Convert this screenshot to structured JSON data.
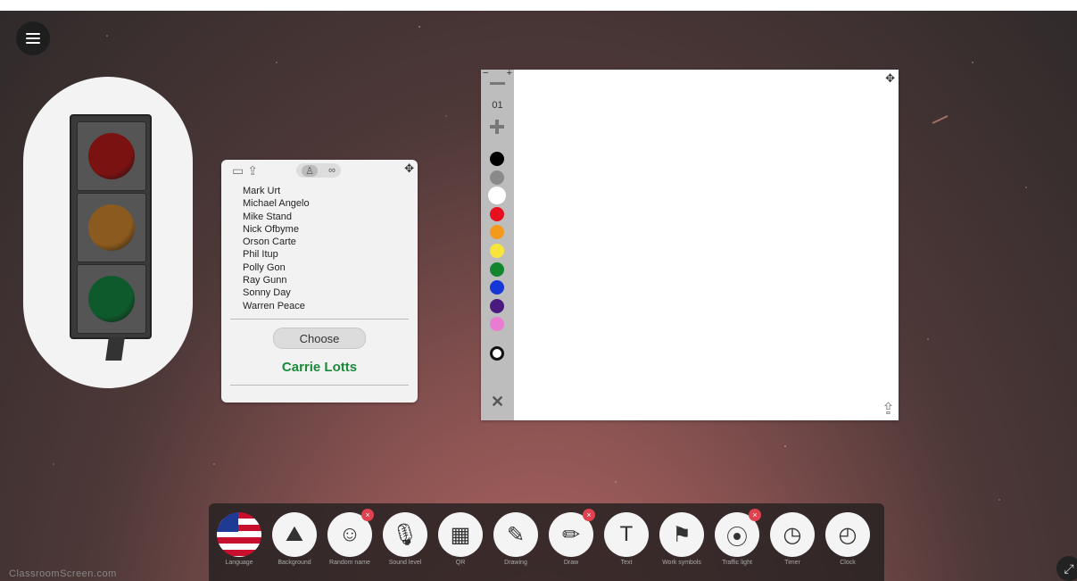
{
  "app": {
    "watermark": "ClassroomScreen.com"
  },
  "menu": {
    "icon": "hamburger-icon"
  },
  "traffic_light": {
    "lamps": [
      {
        "color": "#7a1212"
      },
      {
        "color": "#8a5a1e"
      },
      {
        "color": "#0f5a2c"
      }
    ]
  },
  "name_picker": {
    "names": [
      "Mark Urt",
      "Michael Angelo",
      "Mike Stand",
      "Nick Ofbyme",
      "Orson Carte",
      "Phil Itup",
      "Polly Gon",
      "Ray Gunn",
      "Sonny Day",
      "Warren Peace"
    ],
    "choose_label": "Choose",
    "chosen": "Carrie Lotts",
    "winner_color": "#1a8a3a"
  },
  "drawing": {
    "pen_size": "01",
    "colors": [
      "#000000",
      "#8a8a8a",
      "#ffffff",
      "#e8101f",
      "#f39a1e",
      "#f7e53b",
      "#12852f",
      "#1637d8",
      "#4b1a7f",
      "#e97bd3"
    ],
    "selected_color_index": 2
  },
  "dock": {
    "items": [
      {
        "label": "Language",
        "icon": "us-flag-icon",
        "badge": ""
      },
      {
        "label": "Background",
        "icon": "background-image-icon",
        "badge": ""
      },
      {
        "label": "Random name",
        "icon": "random-name-icon",
        "badge": "×"
      },
      {
        "label": "Sound level",
        "icon": "microphone-icon",
        "badge": ""
      },
      {
        "label": "QR",
        "icon": "qr-code-icon",
        "badge": ""
      },
      {
        "label": "Drawing",
        "icon": "drawing-icon",
        "badge": ""
      },
      {
        "label": "Draw",
        "icon": "draw-icon",
        "badge": "×"
      },
      {
        "label": "Text",
        "icon": "text-icon",
        "badge": ""
      },
      {
        "label": "Work symbols",
        "icon": "work-symbols-icon",
        "badge": ""
      },
      {
        "label": "Traffic light",
        "icon": "traffic-light-icon",
        "badge": "×"
      },
      {
        "label": "Timer",
        "icon": "timer-icon",
        "badge": ""
      },
      {
        "label": "Clock",
        "icon": "clock-icon",
        "badge": ""
      }
    ]
  }
}
